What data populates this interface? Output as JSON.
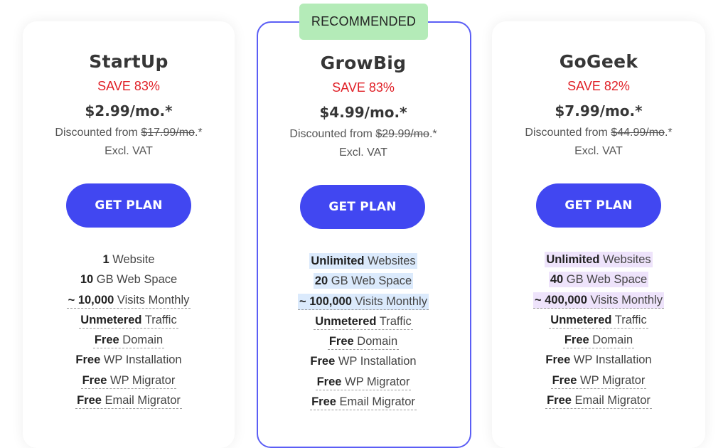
{
  "recommended_badge": "RECOMMENDED",
  "colors": {
    "accent_button": "#4147f1",
    "recommended_border": "#5b5ef5",
    "recommended_badge_bg": "#b4ebb8",
    "save_text": "#e01f26",
    "highlight_growbig": "#dbeafc",
    "highlight_gogeek": "#eee3fb"
  },
  "plans": [
    {
      "name": "StartUp",
      "save": "SAVE 83%",
      "price": "$2.99/mo.*",
      "discount_prefix": "Discounted from ",
      "original_price": "$17.99/mo",
      "discount_suffix": ".*",
      "vat": "Excl. VAT",
      "button": "GET PLAN",
      "features": [
        {
          "bold": "1",
          "text": " Website"
        },
        {
          "bold": "10",
          "text": " GB Web Space"
        },
        {
          "bold": "~ 10,000",
          "text": " Visits Monthly"
        },
        {
          "bold": "Unmetered",
          "text": " Traffic"
        },
        {
          "bold": "Free",
          "text": " Domain"
        },
        {
          "bold": "Free",
          "text": " WP Installation"
        },
        {
          "bold": "Free",
          "text": " WP Migrator"
        },
        {
          "bold": "Free",
          "text": " Email Migrator"
        }
      ]
    },
    {
      "name": "GrowBig",
      "save": "SAVE 83%",
      "price": "$4.99/mo.*",
      "discount_prefix": "Discounted from ",
      "original_price": "$29.99/mo",
      "discount_suffix": ".*",
      "vat": "Excl. VAT",
      "button": "GET PLAN",
      "features": [
        {
          "bold": "Unlimited",
          "text": " Websites"
        },
        {
          "bold": "20",
          "text": " GB Web Space"
        },
        {
          "bold": "~ 100,000",
          "text": " Visits Monthly"
        },
        {
          "bold": "Unmetered",
          "text": " Traffic"
        },
        {
          "bold": "Free",
          "text": " Domain"
        },
        {
          "bold": "Free",
          "text": " WP Installation"
        },
        {
          "bold": "Free",
          "text": " WP Migrator"
        },
        {
          "bold": "Free",
          "text": " Email Migrator"
        }
      ]
    },
    {
      "name": "GoGeek",
      "save": "SAVE 82%",
      "price": "$7.99/mo.*",
      "discount_prefix": "Discounted from ",
      "original_price": "$44.99/mo",
      "discount_suffix": ".*",
      "vat": "Excl. VAT",
      "button": "GET PLAN",
      "features": [
        {
          "bold": "Unlimited",
          "text": " Websites"
        },
        {
          "bold": "40",
          "text": " GB Web Space"
        },
        {
          "bold": "~ 400,000",
          "text": " Visits Monthly"
        },
        {
          "bold": "Unmetered",
          "text": " Traffic"
        },
        {
          "bold": "Free",
          "text": " Domain"
        },
        {
          "bold": "Free",
          "text": " WP Installation"
        },
        {
          "bold": "Free",
          "text": " WP Migrator"
        },
        {
          "bold": "Free",
          "text": " Email Migrator"
        }
      ]
    }
  ]
}
